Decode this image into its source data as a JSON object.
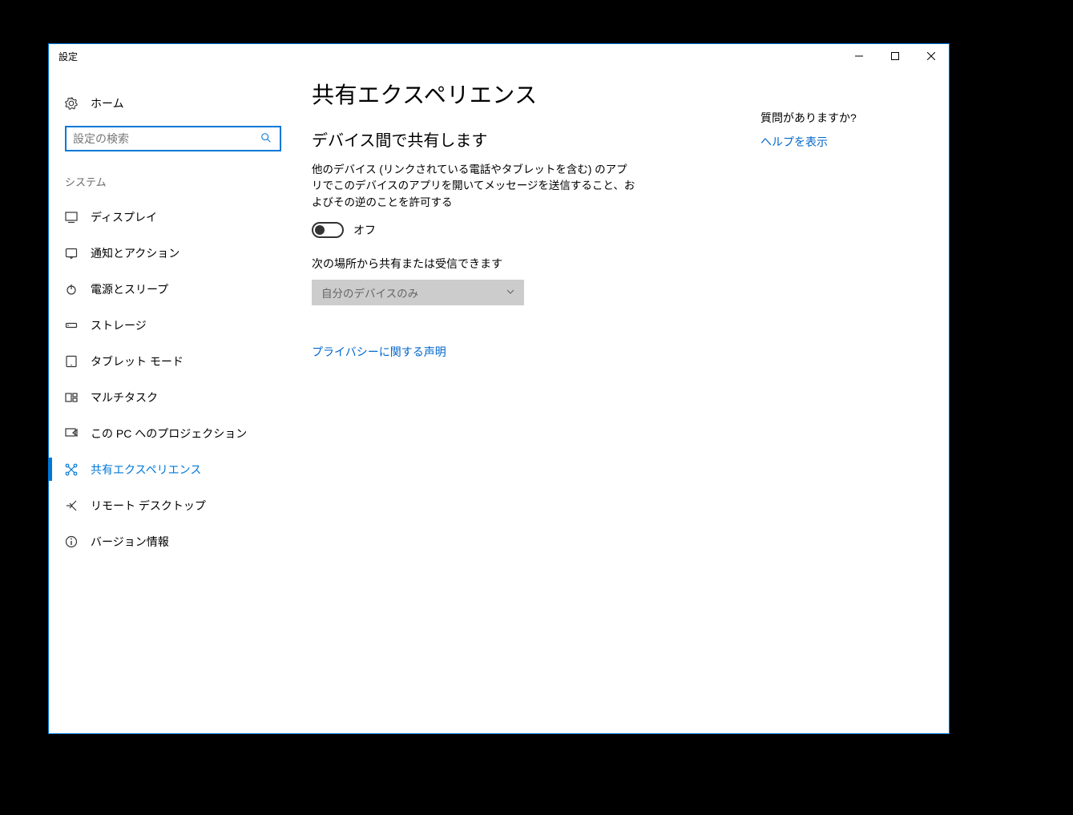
{
  "window": {
    "title": "設定"
  },
  "sidebar": {
    "home": "ホーム",
    "search_placeholder": "設定の検索",
    "category": "システム",
    "items": [
      {
        "label": "ディスプレイ"
      },
      {
        "label": "通知とアクション"
      },
      {
        "label": "電源とスリープ"
      },
      {
        "label": "ストレージ"
      },
      {
        "label": "タブレット モード"
      },
      {
        "label": "マルチタスク"
      },
      {
        "label": "この PC へのプロジェクション"
      },
      {
        "label": "共有エクスペリエンス"
      },
      {
        "label": "リモート デスクトップ"
      },
      {
        "label": "バージョン情報"
      }
    ]
  },
  "main": {
    "title": "共有エクスペリエンス",
    "section1_title": "デバイス間で共有します",
    "section1_desc": "他のデバイス (リンクされている電話やタブレットを含む) のアプリでこのデバイスのアプリを開いてメッセージを送信すること、およびその逆のことを許可する",
    "toggle_state": "オフ",
    "share_from_label": "次の場所から共有または受信できます",
    "share_from_value": "自分のデバイスのみ",
    "privacy_link": "プライバシーに関する声明"
  },
  "help": {
    "heading": "質問がありますか?",
    "link": "ヘルプを表示"
  }
}
